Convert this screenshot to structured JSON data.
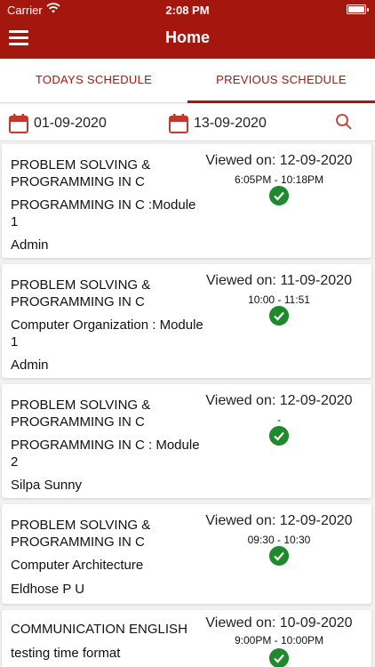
{
  "status_bar": {
    "carrier": "Carrier",
    "time": "2:08 PM"
  },
  "header": {
    "title": "Home"
  },
  "tabs": [
    {
      "label": "TODAYS SCHEDULE",
      "active": false
    },
    {
      "label": "PREVIOUS SCHEDULE",
      "active": true
    }
  ],
  "filters": {
    "from_date": "01-09-2020",
    "to_date": "13-09-2020"
  },
  "schedule": [
    {
      "course": "PROBLEM SOLVING & PROGRAMMING IN C",
      "module": "PROGRAMMING IN C :Module 1",
      "author": "Admin",
      "viewed": "Viewed on: 12-09-2020",
      "time": "6:05PM - 10:18PM"
    },
    {
      "course": "PROBLEM SOLVING & PROGRAMMING IN C",
      "module": "Computer Organization : Module 1",
      "author": "Admin",
      "viewed": "Viewed on: 11-09-2020",
      "time": "10:00 - 11:51"
    },
    {
      "course": "PROBLEM SOLVING & PROGRAMMING IN C",
      "module": "PROGRAMMING IN C : Module 2",
      "author": "Silpa Sunny",
      "viewed": "Viewed on: 12-09-2020",
      "time": "-"
    },
    {
      "course": "PROBLEM SOLVING & PROGRAMMING IN C",
      "module": "Computer Architecture",
      "author": "Eldhose P U",
      "viewed": "Viewed on: 12-09-2020",
      "time": "09:30 - 10:30"
    },
    {
      "course": "COMMUNICATION ENGLISH",
      "module": "testing time format",
      "author": "",
      "viewed": "Viewed on: 10-09-2020",
      "time": "9:00PM - 10:00PM"
    }
  ],
  "colors": {
    "brand": "#a3170f",
    "success": "#1f8a2d"
  }
}
